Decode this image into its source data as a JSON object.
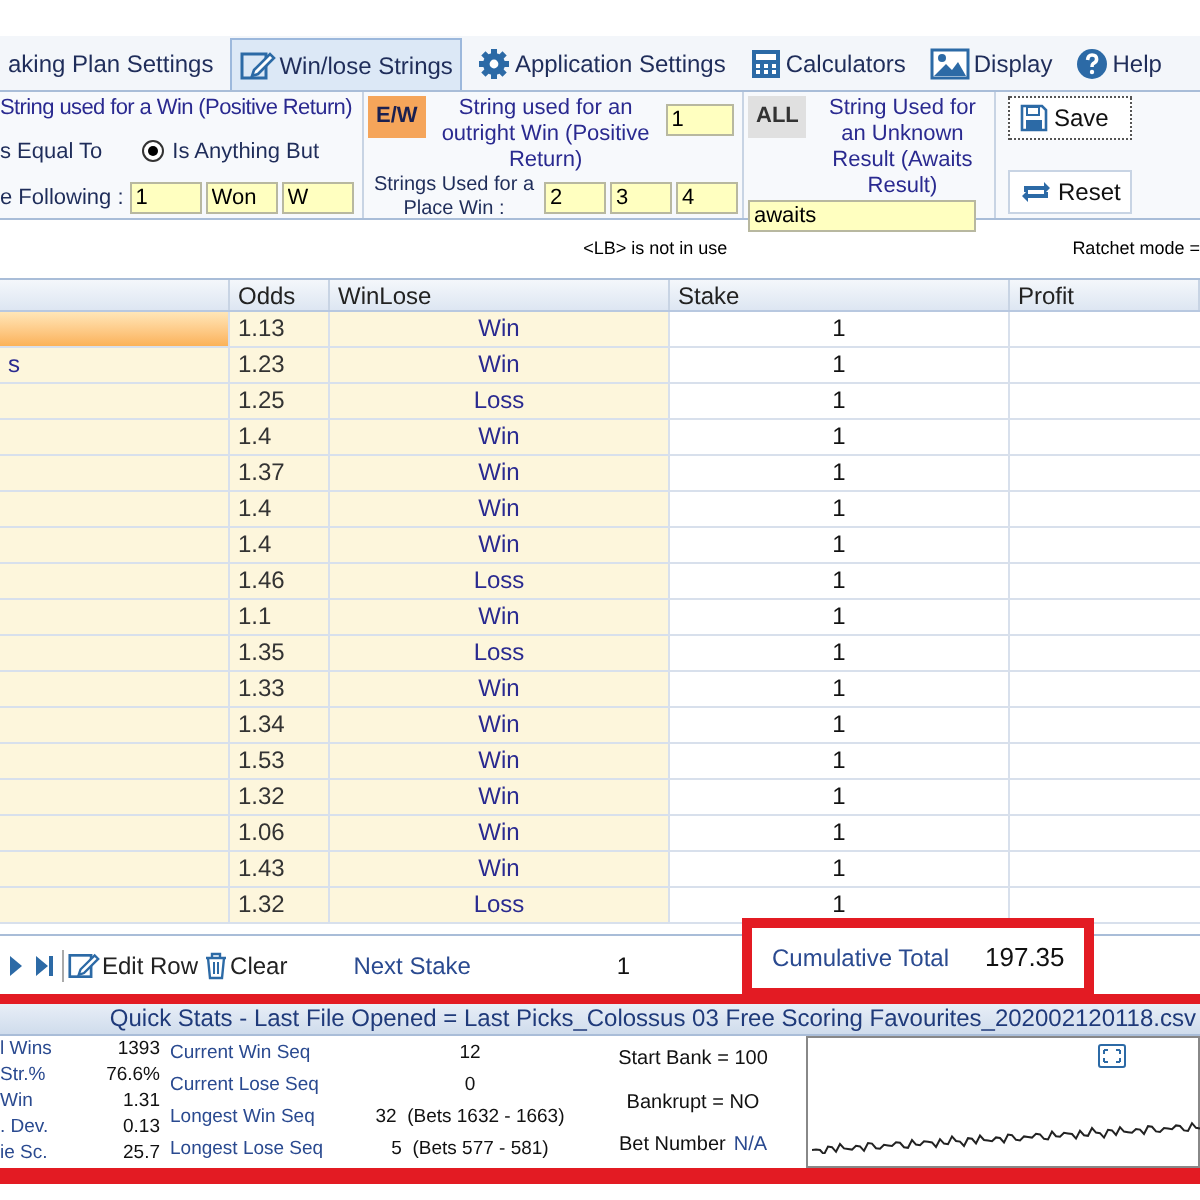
{
  "tabs": [
    {
      "label": "aking Plan Settings",
      "selected": false
    },
    {
      "label": "Win/lose Strings",
      "selected": true
    },
    {
      "label": "Application Settings",
      "selected": false
    },
    {
      "label": "Calculators",
      "selected": false
    },
    {
      "label": "Display",
      "selected": false
    },
    {
      "label": "Help",
      "selected": false
    }
  ],
  "win_strings": {
    "title": "String used for a Win (Positive Return)",
    "equal_label": "s Equal To",
    "anything_but": {
      "label": "Is Anything But",
      "selected": true
    },
    "following_label": "e Following :",
    "values": [
      "1",
      "Won",
      "W"
    ]
  },
  "each_way": {
    "badge": "E/W",
    "outright_label": "String used for an outright Win (Positive Return)",
    "outright_value": "1",
    "place_label": "Strings Used for a Place Win :",
    "place_values": [
      "2",
      "3",
      "4"
    ]
  },
  "unknown": {
    "badge": "ALL",
    "label": "String Used for an Unknown Result (Awaits Result)",
    "value": "awaits"
  },
  "buttons": [
    {
      "label": "Save"
    },
    {
      "label": "Reset"
    }
  ],
  "info": {
    "lb": "<LB> is not in use",
    "ratchet": "Ratchet mode ="
  },
  "table": {
    "columns": [
      "Odds",
      "WinLose",
      "Stake",
      "Profit"
    ],
    "rows": [
      {
        "name": "",
        "odds": "1.13",
        "result": "Win",
        "stake": "1",
        "selected": true
      },
      {
        "name": "s",
        "odds": "1.23",
        "result": "Win",
        "stake": "1",
        "selected": false
      },
      {
        "name": "",
        "odds": "1.25",
        "result": "Loss",
        "stake": "1",
        "selected": false
      },
      {
        "name": "",
        "odds": "1.4",
        "result": "Win",
        "stake": "1",
        "selected": false
      },
      {
        "name": "",
        "odds": "1.37",
        "result": "Win",
        "stake": "1",
        "selected": false
      },
      {
        "name": "",
        "odds": "1.4",
        "result": "Win",
        "stake": "1",
        "selected": false
      },
      {
        "name": "",
        "odds": "1.4",
        "result": "Win",
        "stake": "1",
        "selected": false
      },
      {
        "name": "",
        "odds": "1.46",
        "result": "Loss",
        "stake": "1",
        "selected": false
      },
      {
        "name": "",
        "odds": "1.1",
        "result": "Win",
        "stake": "1",
        "selected": false
      },
      {
        "name": "",
        "odds": "1.35",
        "result": "Loss",
        "stake": "1",
        "selected": false
      },
      {
        "name": "",
        "odds": "1.33",
        "result": "Win",
        "stake": "1",
        "selected": false
      },
      {
        "name": "",
        "odds": "1.34",
        "result": "Win",
        "stake": "1",
        "selected": false
      },
      {
        "name": "",
        "odds": "1.53",
        "result": "Win",
        "stake": "1",
        "selected": false
      },
      {
        "name": "",
        "odds": "1.32",
        "result": "Win",
        "stake": "1",
        "selected": false
      },
      {
        "name": "",
        "odds": "1.06",
        "result": "Win",
        "stake": "1",
        "selected": false
      },
      {
        "name": "",
        "odds": "1.43",
        "result": "Win",
        "stake": "1",
        "selected": false
      },
      {
        "name": "",
        "odds": "1.32",
        "result": "Loss",
        "stake": "1",
        "selected": false
      }
    ]
  },
  "toolbar": {
    "edit_row": "Edit Row",
    "clear": "Clear",
    "next_stake_label": "Next Stake",
    "next_stake": "1",
    "cumulative_label": "Cumulative Total",
    "cumulative": "197.35"
  },
  "quick_stats": {
    "title": "Quick Stats - Last File Opened = Last Picks_Colossus 03 Free Scoring Favourites_202002120118.csv",
    "left": [
      {
        "label": "l Wins",
        "value": "1393"
      },
      {
        "label": "Str.%",
        "value": "76.6%"
      },
      {
        "label": "Win",
        "value": "1.31"
      },
      {
        "label": ". Dev.",
        "value": "0.13"
      },
      {
        "label": "ie Sc.",
        "value": "25.7"
      }
    ],
    "sequences": [
      {
        "label": "Current Win Seq",
        "value": "12"
      },
      {
        "label": "Current Lose Seq",
        "value": "0"
      },
      {
        "label": "Longest Win Seq",
        "value": "32  (Bets 1632 - 1663)"
      },
      {
        "label": "Longest Lose Seq",
        "value": "5  (Bets 577 - 581)"
      }
    ],
    "start_bank": "Start Bank = 100",
    "bankrupt": "Bankrupt = NO",
    "bet_number_label": "Bet Number",
    "bet_number": "N/A"
  }
}
